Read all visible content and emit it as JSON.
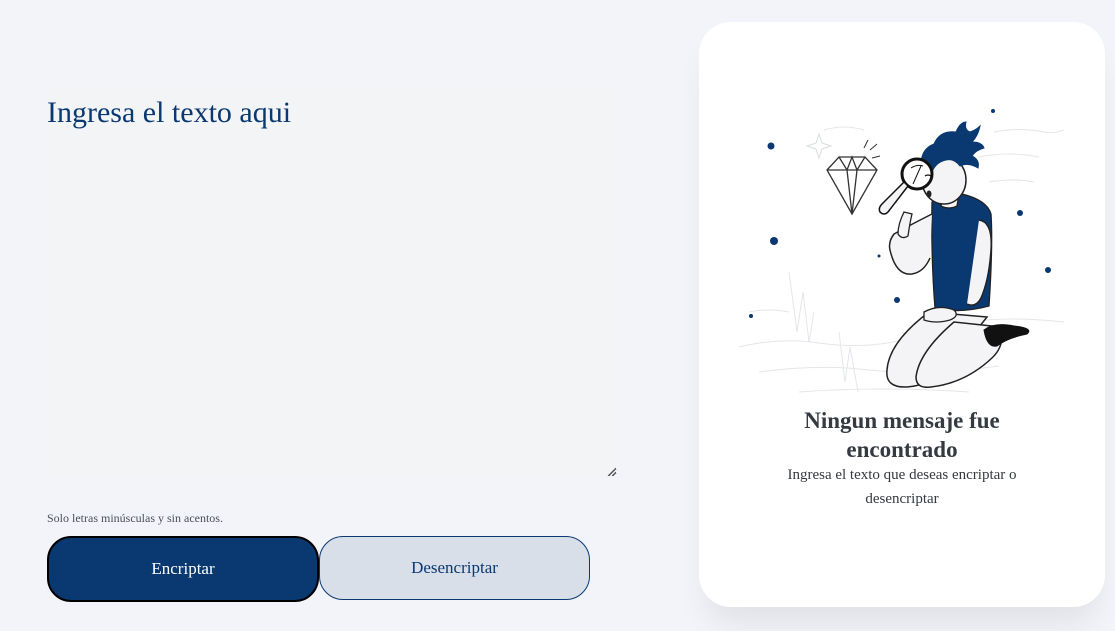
{
  "input": {
    "placeholder": "Ingresa el texto aqui",
    "value": ""
  },
  "hint": {
    "text": "Solo letras minúsculas y sin acentos."
  },
  "buttons": {
    "encrypt_label": "Encriptar",
    "decrypt_label": "Desencriptar"
  },
  "result_panel": {
    "title": "Ningun mensaje fue encontrado",
    "message": "Ingresa el texto que deseas encriptar o desencriptar",
    "illustration_icon": "person-with-magnifying-glass-illustration"
  },
  "colors": {
    "background": "#f3f4f9",
    "primary": "#0a3871",
    "secondary_button": "#d8dfe8",
    "card": "#ffffff",
    "text_dark": "#343a40"
  }
}
